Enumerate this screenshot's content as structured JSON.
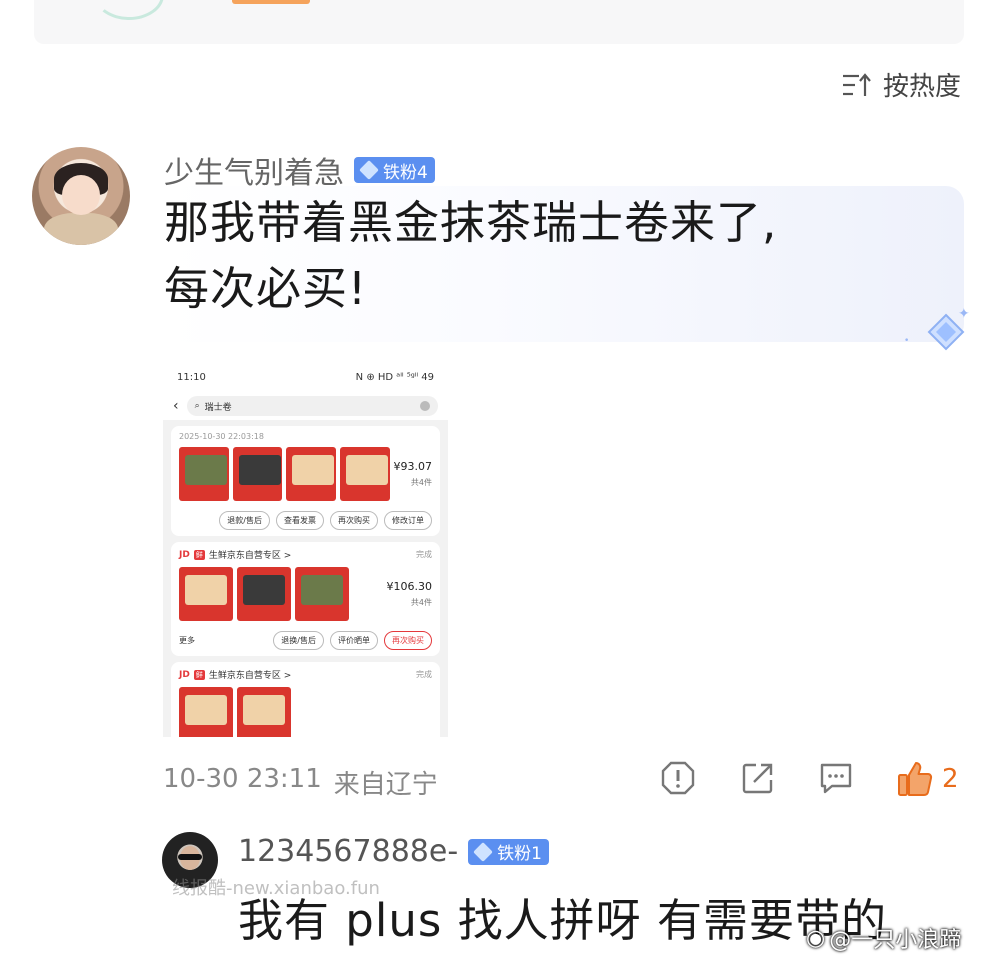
{
  "sort": {
    "label": "按热度"
  },
  "comment": {
    "username": "少生气别着急",
    "badge": "铁粉4",
    "text_line1": "那我带着黑金抹茶瑞士卷来了,",
    "text_line2": "每次必买!",
    "date": "10-30 23:11",
    "location": "来自辽宁",
    "likes": "2"
  },
  "screenshot": {
    "time": "11:10",
    "status_icons": "N ⊕ HD ᵃˡˡ ⁵ᵍˡˡ 49",
    "search_query": "瑞士卷",
    "order1": {
      "timestamp": "2025-10-30 22:03:18",
      "price": "¥93.07",
      "count": "共4件",
      "buttons": [
        "退款/售后",
        "查看发票",
        "再次购买",
        "修改订单"
      ]
    },
    "order2": {
      "jd": "JD",
      "fresh": "鲜",
      "store": "生鲜京东自营专区 >",
      "status": "完成",
      "price": "¥106.30",
      "count": "共4件",
      "more": "更多",
      "buttons": [
        "退换/售后",
        "评价晒单",
        "再次购买"
      ]
    },
    "order3": {
      "jd": "JD",
      "fresh": "鲜",
      "store": "生鲜京东自营专区 >",
      "status": "完成"
    }
  },
  "reply": {
    "username": "1234567888e-",
    "badge": "铁粉1",
    "text": "我有 plus 找人拼呀 有需要带的"
  },
  "watermarks": {
    "site": "线报酷-new.xianbao.fun",
    "weibo": "@一只小浪蹄"
  },
  "colors": {
    "badge_blue": "#5b8ff0",
    "like_orange": "#e86c1c",
    "jd_red": "#e4393c"
  },
  "icons": [
    "sort-icon",
    "report-icon",
    "share-icon",
    "comment-icon",
    "like-icon",
    "diamond-icon",
    "gem-icon"
  ]
}
